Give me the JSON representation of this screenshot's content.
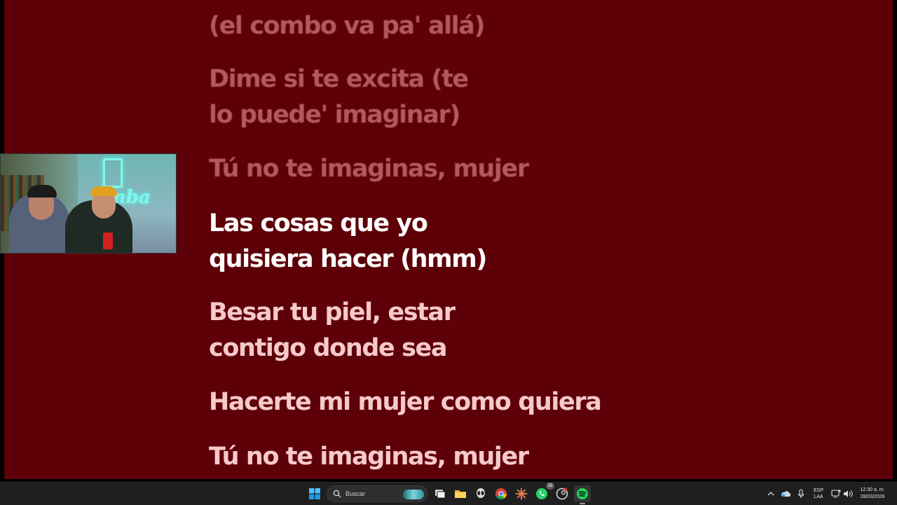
{
  "lyrics": {
    "lines": [
      {
        "text": "(el combo va pa' allá)",
        "state": "past"
      },
      {
        "text": "Dime si te excita (te\nlo puede' imaginar)",
        "state": "past"
      },
      {
        "text": "Tú no te imaginas, mujer",
        "state": "past"
      },
      {
        "text": "Las cosas que yo\nquisiera hacer (hmm)",
        "state": "active"
      },
      {
        "text": "Besar tu piel, estar\ncontigo donde sea",
        "state": "upcoming"
      },
      {
        "text": "Hacerte mi mujer como quiera",
        "state": "upcoming"
      },
      {
        "text": "Tú no te imaginas, mujer",
        "state": "upcoming"
      }
    ],
    "background_color": "#5e0007"
  },
  "taskbar": {
    "search_placeholder": "Buscar",
    "apps": [
      "windows-start-icon",
      "task-view-icon",
      "file-explorer-icon",
      "alien-app-icon",
      "chrome-icon",
      "claude-icon",
      "whatsapp-icon",
      "steam-icon",
      "spotify-icon"
    ],
    "whatsapp_badge": "33",
    "language": {
      "line1": "ESP",
      "line2": "LAA"
    },
    "time": "12:30 a. m.",
    "date": "28/03/2026"
  }
}
